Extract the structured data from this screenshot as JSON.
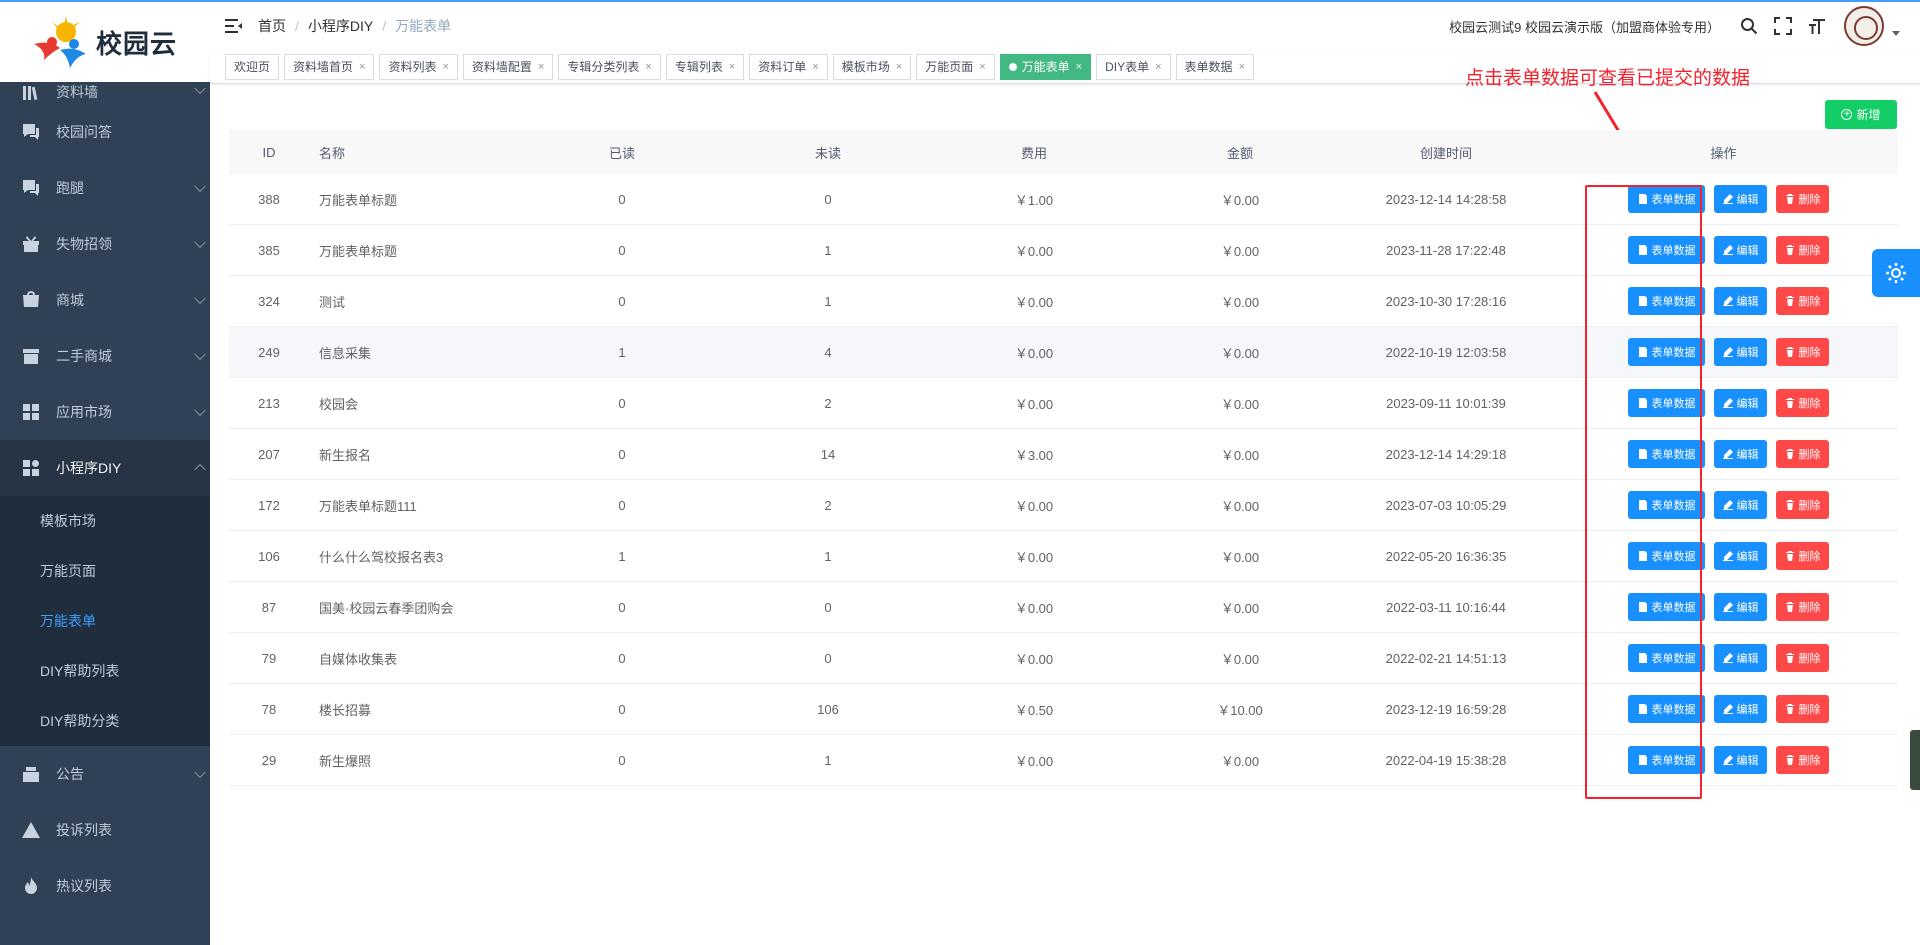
{
  "brand": {
    "name": "校园云"
  },
  "sidebar": {
    "items": [
      {
        "label": "资料墙",
        "icon": "books-icon",
        "expandable": true
      },
      {
        "label": "校园问答",
        "icon": "question-chat-icon",
        "expandable": false
      },
      {
        "label": "跑腿",
        "icon": "question-chat-icon",
        "expandable": true
      },
      {
        "label": "失物招领",
        "icon": "gift-icon",
        "expandable": true
      },
      {
        "label": "商城",
        "icon": "shop-icon",
        "expandable": true
      },
      {
        "label": "二手商城",
        "icon": "store-icon",
        "expandable": true
      },
      {
        "label": "应用市场",
        "icon": "apps-icon",
        "expandable": true
      },
      {
        "label": "小程序DIY",
        "icon": "apps-icon",
        "expandable": true,
        "open": true
      },
      {
        "label": "公告",
        "icon": "notice-icon",
        "expandable": true
      },
      {
        "label": "投诉列表",
        "icon": "warning-icon",
        "expandable": false
      },
      {
        "label": "热议列表",
        "icon": "fire-icon",
        "expandable": false
      }
    ],
    "submenu": [
      {
        "label": "模板市场"
      },
      {
        "label": "万能页面"
      },
      {
        "label": "万能表单",
        "active": true
      },
      {
        "label": "DIY帮助列表"
      },
      {
        "label": "DIY帮助分类"
      }
    ]
  },
  "header": {
    "breadcrumb": [
      "首页",
      "小程序DIY",
      "万能表单"
    ],
    "user_text": "校园云测试9 校园云演示版（加盟商体验专用）"
  },
  "tags": [
    {
      "label": "欢迎页",
      "closable": false
    },
    {
      "label": "资料墙首页",
      "closable": true
    },
    {
      "label": "资料列表",
      "closable": true
    },
    {
      "label": "资料墙配置",
      "closable": true
    },
    {
      "label": "专辑分类列表",
      "closable": true
    },
    {
      "label": "专辑列表",
      "closable": true
    },
    {
      "label": "资料订单",
      "closable": true
    },
    {
      "label": "模板市场",
      "closable": true
    },
    {
      "label": "万能页面",
      "closable": true
    },
    {
      "label": "万能表单",
      "closable": true,
      "active": true
    },
    {
      "label": "DIY表单",
      "closable": true
    },
    {
      "label": "表单数据",
      "closable": true
    }
  ],
  "annotation": {
    "text": "点击表单数据可查看已提交的数据"
  },
  "toolbar": {
    "add_label": "新增"
  },
  "table": {
    "headers": {
      "id": "ID",
      "name": "名称",
      "read": "已读",
      "unread": "未读",
      "fee": "费用",
      "amount": "金额",
      "time": "创建时间",
      "op": "操作"
    },
    "buttons": {
      "form": "表单数据",
      "edit": "编辑",
      "delete": "删除"
    },
    "rows": [
      {
        "id": "388",
        "name": "万能表单标题",
        "read": "0",
        "unread": "0",
        "fee": "￥1.00",
        "amount": "￥0.00",
        "time": "2023-12-14 14:28:58"
      },
      {
        "id": "385",
        "name": "万能表单标题",
        "read": "0",
        "unread": "1",
        "fee": "￥0.00",
        "amount": "￥0.00",
        "time": "2023-11-28 17:22:48"
      },
      {
        "id": "324",
        "name": "测试",
        "read": "0",
        "unread": "1",
        "fee": "￥0.00",
        "amount": "￥0.00",
        "time": "2023-10-30 17:28:16"
      },
      {
        "id": "249",
        "name": "信息采集",
        "read": "1",
        "unread": "4",
        "fee": "￥0.00",
        "amount": "￥0.00",
        "time": "2022-10-19 12:03:58"
      },
      {
        "id": "213",
        "name": "校园会",
        "read": "0",
        "unread": "2",
        "fee": "￥0.00",
        "amount": "￥0.00",
        "time": "2023-09-11 10:01:39"
      },
      {
        "id": "207",
        "name": "新生报名",
        "read": "0",
        "unread": "14",
        "fee": "￥3.00",
        "amount": "￥0.00",
        "time": "2023-12-14 14:29:18"
      },
      {
        "id": "172",
        "name": "万能表单标题111",
        "read": "0",
        "unread": "2",
        "fee": "￥0.00",
        "amount": "￥0.00",
        "time": "2023-07-03 10:05:29"
      },
      {
        "id": "106",
        "name": "什么什么驾校报名表3",
        "read": "1",
        "unread": "1",
        "fee": "￥0.00",
        "amount": "￥0.00",
        "time": "2022-05-20 16:36:35"
      },
      {
        "id": "87",
        "name": "国美·校园云春季团购会",
        "read": "0",
        "unread": "0",
        "fee": "￥0.00",
        "amount": "￥0.00",
        "time": "2022-03-11 10:16:44"
      },
      {
        "id": "79",
        "name": "自媒体收集表",
        "read": "0",
        "unread": "0",
        "fee": "￥0.00",
        "amount": "￥0.00",
        "time": "2022-02-21 14:51:13"
      },
      {
        "id": "78",
        "name": "楼长招募",
        "read": "0",
        "unread": "106",
        "fee": "￥0.50",
        "amount": "￥10.00",
        "time": "2023-12-19 16:59:28"
      },
      {
        "id": "29",
        "name": "新生爆照",
        "read": "0",
        "unread": "1",
        "fee": "￥0.00",
        "amount": "￥0.00",
        "time": "2022-04-19 15:38:28"
      }
    ]
  },
  "colors": {
    "sidebar_bg": "#304156",
    "primary": "#1890ff",
    "success": "#13ce66",
    "danger": "#ff4949",
    "tag_active": "#42b983",
    "annotation": "#f5222d"
  }
}
